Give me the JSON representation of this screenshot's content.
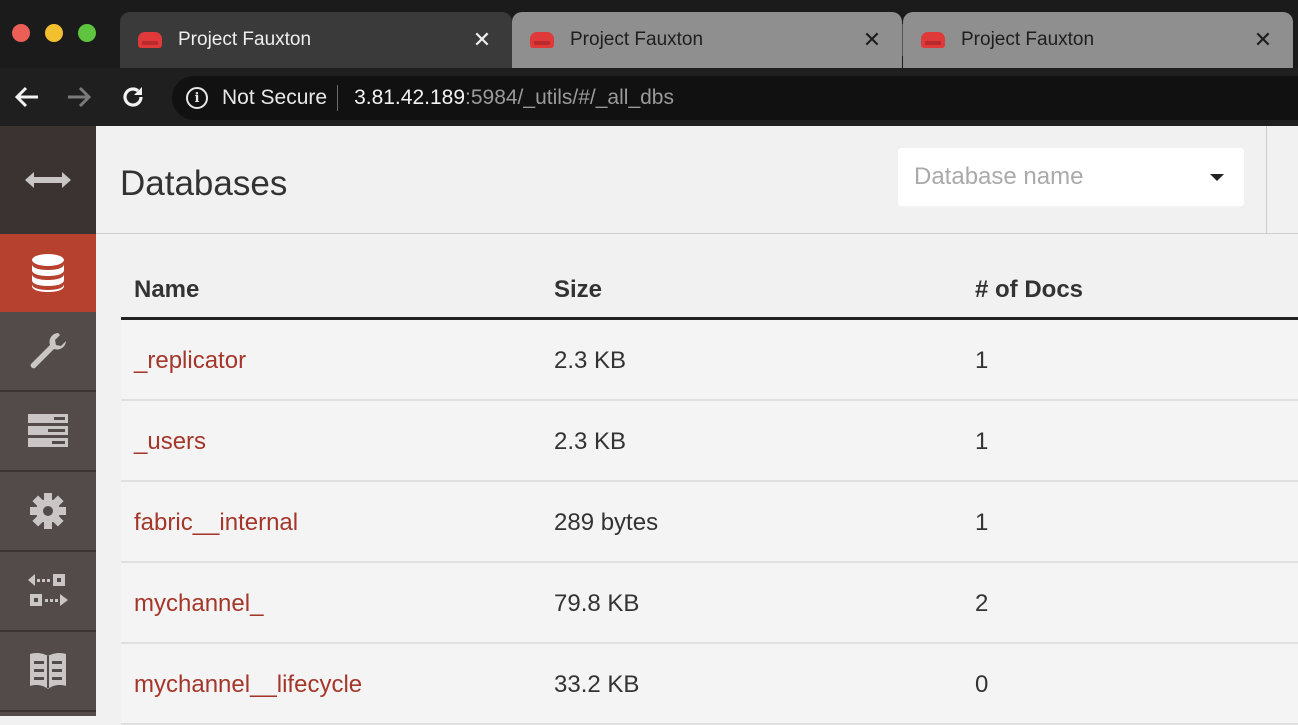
{
  "browser": {
    "tabs": [
      {
        "title": "Project Fauxton",
        "active": true
      },
      {
        "title": "Project Fauxton",
        "active": false
      },
      {
        "title": "Project Fauxton",
        "active": false
      }
    ],
    "tab_close_glyph": "✕",
    "security_label": "Not Secure",
    "url_host": "3.81.42.189",
    "url_rest": ":5984/_utils/#/_all_dbs"
  },
  "sidebar": {
    "items": [
      {
        "name": "toggle-menu",
        "icon": "double-arrow-icon"
      },
      {
        "name": "databases",
        "icon": "database-icon",
        "active": true
      },
      {
        "name": "setup",
        "icon": "wrench-icon"
      },
      {
        "name": "active-tasks",
        "icon": "server-list-icon"
      },
      {
        "name": "configuration",
        "icon": "gear-icon"
      },
      {
        "name": "replication",
        "icon": "replication-icon"
      },
      {
        "name": "documentation",
        "icon": "book-icon"
      }
    ]
  },
  "header": {
    "title": "Databases",
    "db_select_placeholder": "Database name"
  },
  "table": {
    "columns": [
      "Name",
      "Size",
      "# of Docs"
    ],
    "rows": [
      {
        "name": "_replicator",
        "size": "2.3 KB",
        "docs": "1"
      },
      {
        "name": "_users",
        "size": "2.3 KB",
        "docs": "1"
      },
      {
        "name": "fabric__internal",
        "size": "289 bytes",
        "docs": "1"
      },
      {
        "name": "mychannel_",
        "size": "79.8 KB",
        "docs": "2"
      },
      {
        "name": "mychannel__lifecycle",
        "size": "33.2 KB",
        "docs": "0"
      }
    ]
  },
  "colors": {
    "accent": "#b7412f",
    "link": "#a4362a",
    "sidebar_bg": "#534b49"
  }
}
